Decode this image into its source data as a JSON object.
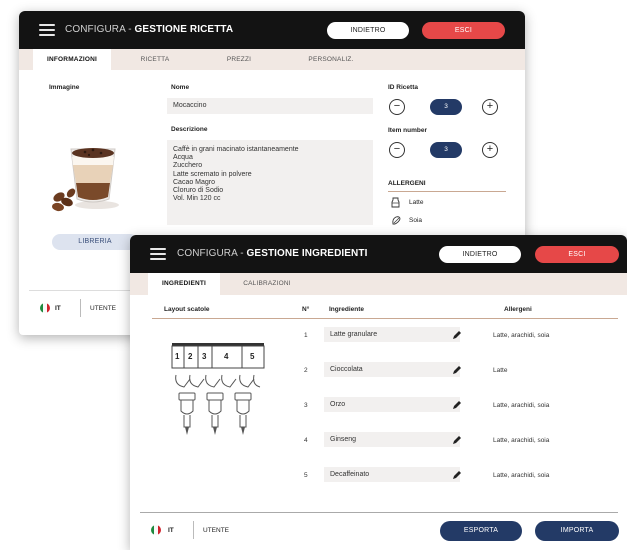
{
  "recipe_window": {
    "title_prefix": "CONFIGURA - ",
    "title_main": "GESTIONE RICETTA",
    "back_label": "INDIETRO",
    "exit_label": "ESCI",
    "tabs": [
      "INFORMAZIONI",
      "RICETTA",
      "PREZZI",
      "PERSONALIZ."
    ],
    "image_label": "Immagine",
    "library_label": "LIBRERIA",
    "name_label": "Nome",
    "name_value": "Mocaccino",
    "description_label": "Descrizione",
    "description_lines": [
      "Caffè in grani macinato istantaneamente",
      "Acqua",
      "Zucchero",
      "Latte scremato in polvere",
      "Cacao Magro",
      "Cloruro di Sodio",
      "Vol. Min 120 cc"
    ],
    "recipe_id_label": "ID Ricetta",
    "recipe_id_value": "3",
    "item_number_label": "Item number",
    "item_number_value": "3",
    "allergens_title": "ALLERGENI",
    "allergens": [
      "Latte",
      "Soia"
    ],
    "language": "IT",
    "user_label": "UTENTE"
  },
  "ingredients_window": {
    "title_prefix": "CONFIGURA - ",
    "title_main": "GESTIONE INGREDIENTI",
    "back_label": "INDIETRO",
    "exit_label": "ESCI",
    "tabs": [
      "INGREDIENTI",
      "CALIBRAZIONI"
    ],
    "layout_label": "Layout scatole",
    "canister_numbers": [
      "1",
      "2",
      "3",
      "4",
      "5"
    ],
    "columns": {
      "number": "N°",
      "ingredient": "Ingrediente",
      "allergens": "Allergeni"
    },
    "rows": [
      {
        "n": "1",
        "ingredient": "Latte granulare",
        "allergens": "Latte, arachidi, soia"
      },
      {
        "n": "2",
        "ingredient": "Cioccolata",
        "allergens": "Latte"
      },
      {
        "n": "3",
        "ingredient": "Orzo",
        "allergens": "Latte, arachidi, soia"
      },
      {
        "n": "4",
        "ingredient": "Ginseng",
        "allergens": "Latte, arachidi, soia"
      },
      {
        "n": "5",
        "ingredient": "Decaffeinato",
        "allergens": "Latte, arachidi, soia"
      }
    ],
    "language": "IT",
    "user_label": "UTENTE",
    "export_label": "ESPORTA",
    "import_label": "IMPORTA"
  },
  "colors": {
    "topbar": "#131313",
    "exit_red": "#e64848",
    "navy": "#233a66",
    "tab_band": "#f1e8e3",
    "accent_line": "#c9a892",
    "field_bg": "#f2f0ef"
  }
}
